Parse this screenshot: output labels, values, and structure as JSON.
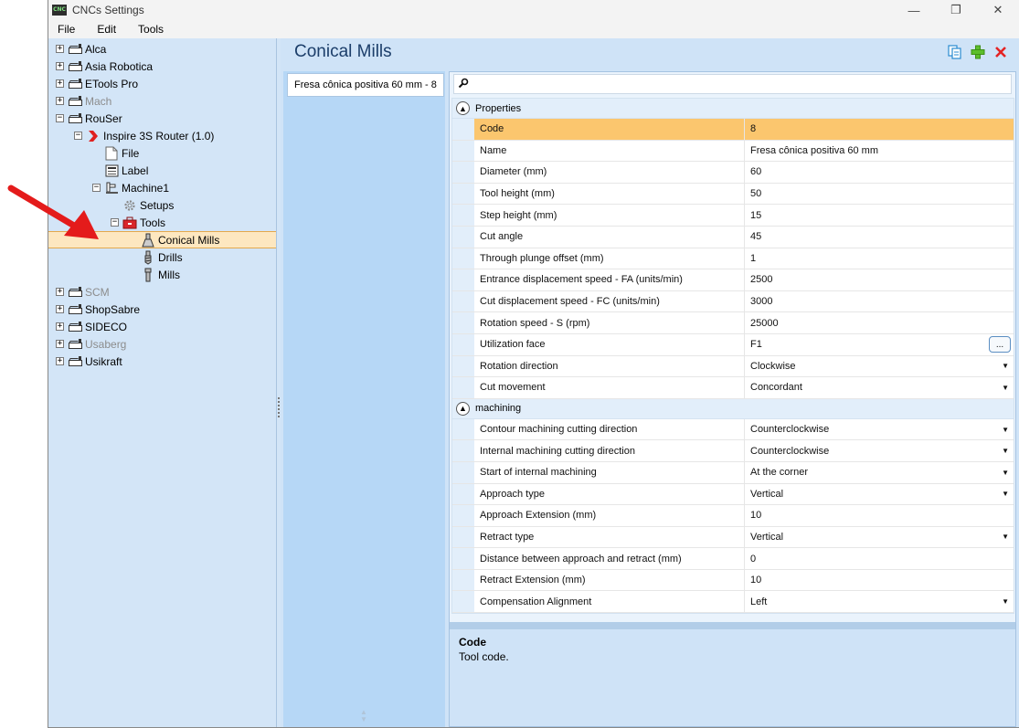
{
  "window": {
    "title": "CNCs Settings",
    "app_icon_text": "CNC",
    "minimize": "—",
    "maximize": "❐",
    "close": "✕"
  },
  "menu": [
    "File",
    "Edit",
    "Tools"
  ],
  "tree": [
    {
      "label": "Alca",
      "level": 0,
      "expander": "+",
      "icon": "factory-icon",
      "disabled": false
    },
    {
      "label": "Asia Robotica",
      "level": 0,
      "expander": "+",
      "icon": "factory-icon",
      "disabled": false
    },
    {
      "label": "ETools Pro",
      "level": 0,
      "expander": "+",
      "icon": "factory-icon",
      "disabled": false
    },
    {
      "label": "Mach",
      "level": 0,
      "expander": "+",
      "icon": "factory-icon",
      "disabled": true
    },
    {
      "label": "RouSer",
      "level": 0,
      "expander": "−",
      "icon": "factory-icon",
      "disabled": false
    },
    {
      "label": "Inspire 3S Router (1.0)",
      "level": 1,
      "expander": "−",
      "icon": "brand-chevron-icon",
      "disabled": false
    },
    {
      "label": "File",
      "level": 2,
      "expander": "",
      "icon": "file-icon",
      "disabled": false
    },
    {
      "label": "Label",
      "level": 2,
      "expander": "",
      "icon": "label-icon",
      "disabled": false
    },
    {
      "label": "Machine1",
      "level": 2,
      "expander": "−",
      "icon": "machine-icon",
      "disabled": false
    },
    {
      "label": "Setups",
      "level": 3,
      "expander": "",
      "icon": "gear-icon",
      "disabled": false
    },
    {
      "label": "Tools",
      "level": 3,
      "expander": "−",
      "icon": "toolbox-icon",
      "disabled": false
    },
    {
      "label": "Conical Mills",
      "level": 4,
      "expander": "",
      "icon": "conical-mill-icon",
      "disabled": false,
      "selected": true
    },
    {
      "label": "Drills",
      "level": 4,
      "expander": "",
      "icon": "drill-icon",
      "disabled": false
    },
    {
      "label": "Mills",
      "level": 4,
      "expander": "",
      "icon": "mill-icon",
      "disabled": false
    },
    {
      "label": "SCM",
      "level": 0,
      "expander": "+",
      "icon": "factory-icon",
      "disabled": true
    },
    {
      "label": "ShopSabre",
      "level": 0,
      "expander": "+",
      "icon": "factory-icon",
      "disabled": false
    },
    {
      "label": "SIDECO",
      "level": 0,
      "expander": "+",
      "icon": "factory-icon",
      "disabled": false
    },
    {
      "label": "Usaberg",
      "level": 0,
      "expander": "+",
      "icon": "factory-icon",
      "disabled": true
    },
    {
      "label": "Usikraft",
      "level": 0,
      "expander": "+",
      "icon": "factory-icon",
      "disabled": false
    }
  ],
  "header": {
    "title": "Conical Mills",
    "actions": [
      "copy-icon",
      "add-icon",
      "delete-icon"
    ]
  },
  "tool_list": [
    "Fresa cônica positiva 60 mm - 8"
  ],
  "search": {
    "placeholder": "",
    "value": ""
  },
  "categories": [
    {
      "label": "Properties",
      "rows": [
        {
          "name": "Code",
          "value": "8",
          "type": "text",
          "selected": true
        },
        {
          "name": "Name",
          "value": "Fresa cônica positiva 60 mm",
          "type": "text"
        },
        {
          "name": "Diameter (mm)",
          "value": "60",
          "type": "text"
        },
        {
          "name": "Tool height (mm)",
          "value": "50",
          "type": "text"
        },
        {
          "name": "Step height (mm)",
          "value": "15",
          "type": "text"
        },
        {
          "name": "Cut angle",
          "value": "45",
          "type": "text"
        },
        {
          "name": "Through plunge offset (mm)",
          "value": "1",
          "type": "text"
        },
        {
          "name": "Entrance displacement speed - FA (units/min)",
          "value": "2500",
          "type": "text"
        },
        {
          "name": "Cut displacement speed - FC (units/min)",
          "value": "3000",
          "type": "text"
        },
        {
          "name": "Rotation speed - S (rpm)",
          "value": "25000",
          "type": "text"
        },
        {
          "name": "Utilization face",
          "value": "F1",
          "type": "ellipsis"
        },
        {
          "name": "Rotation direction",
          "value": "Clockwise",
          "type": "dropdown"
        },
        {
          "name": "Cut movement",
          "value": "Concordant",
          "type": "dropdown"
        }
      ]
    },
    {
      "label": "machining",
      "rows": [
        {
          "name": "Contour machining cutting direction",
          "value": "Counterclockwise",
          "type": "dropdown"
        },
        {
          "name": "Internal machining cutting direction",
          "value": "Counterclockwise",
          "type": "dropdown"
        },
        {
          "name": "Start of internal machining",
          "value": "At the corner",
          "type": "dropdown"
        },
        {
          "name": "Approach type",
          "value": "Vertical",
          "type": "dropdown"
        },
        {
          "name": "Approach Extension (mm)",
          "value": "10",
          "type": "text"
        },
        {
          "name": "Retract type",
          "value": "Vertical",
          "type": "dropdown"
        },
        {
          "name": "Distance between approach and retract (mm)",
          "value": "0",
          "type": "text"
        },
        {
          "name": "Retract Extension (mm)",
          "value": "10",
          "type": "text"
        },
        {
          "name": "Compensation Alignment",
          "value": "Left",
          "type": "dropdown"
        }
      ]
    }
  ],
  "ellipsis_label": "...",
  "dropdown_glyph": "▼",
  "collapse_glyph": "▲",
  "description": {
    "title": "Code",
    "text": "Tool code."
  },
  "colors": {
    "selection": "#fbc66e",
    "tree_selection": "#fde7c0",
    "annotation_arrow": "#e41b1b"
  }
}
